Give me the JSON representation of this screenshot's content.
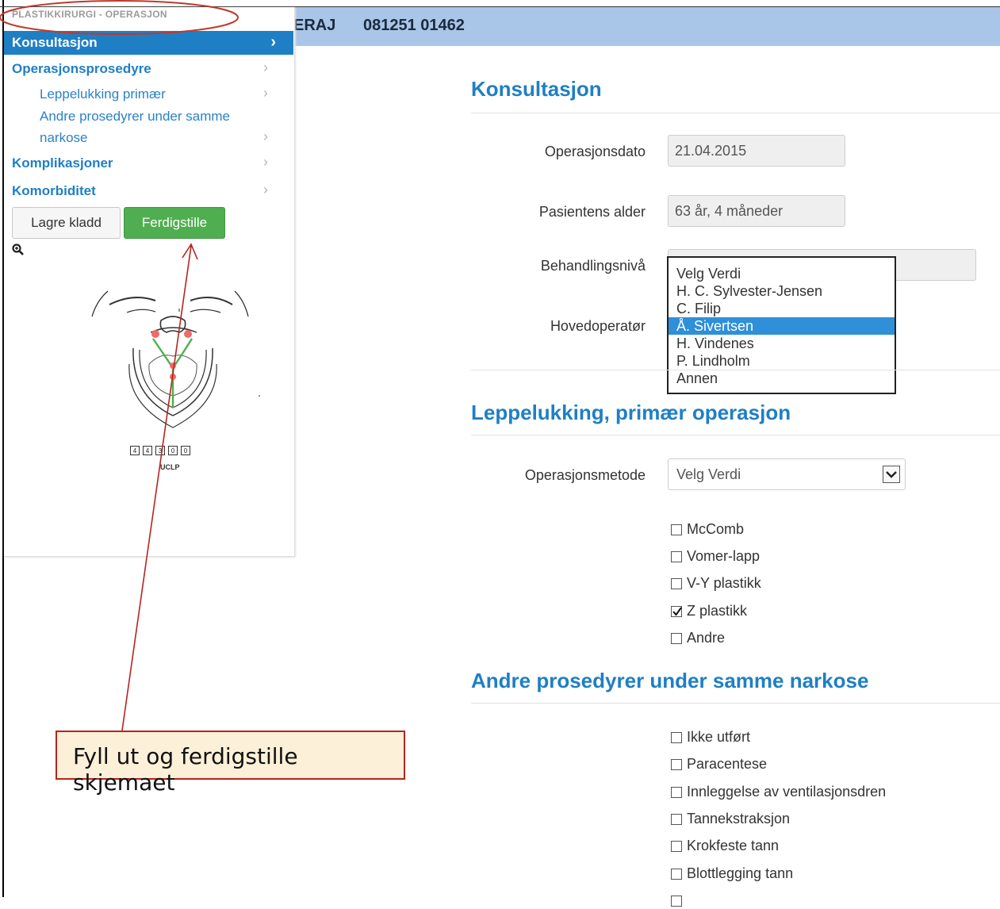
{
  "header": {
    "patient_name_fragment": "ERAJ",
    "patient_id": "081251 01462"
  },
  "sidebar": {
    "title": "PLASTIKKIRURGI - OPERASJON",
    "active_item": "Konsultasjon",
    "items": [
      {
        "label": "Operasjonsprosedyre"
      },
      {
        "label": "Leppelukking primær"
      },
      {
        "label": "Andre prosedyrer under samme"
      },
      {
        "label": "narkose"
      },
      {
        "label": "Komplikasjoner"
      },
      {
        "label": "Komorbiditet"
      }
    ],
    "save_draft_label": "Lagre kladd",
    "finish_label": "Ferdigstille",
    "zoom_icon": "magnifier-icon",
    "diagram_codes": [
      "4",
      "4",
      "3",
      "0",
      "0"
    ],
    "diagram_label": "UCLP"
  },
  "konsultasjon": {
    "title": "Konsultasjon",
    "operasjonsdato_label": "Operasjonsdato",
    "operasjonsdato_value": "21.04.2015",
    "alder_label": "Pasientens alder",
    "alder_value": "63 år, 4 måneder",
    "behandlingsniva_label": "Behandlingsnivå",
    "hovedoperator_label": "Hovedoperatør",
    "hovedoperator_options": [
      "Velg Verdi",
      "H. C. Sylvester-Jensen",
      "C. Filip",
      "Å. Sivertsen",
      "H. Vindenes",
      "P. Lindholm",
      "Annen"
    ],
    "hovedoperator_selected": "Å. Sivertsen"
  },
  "leppelukking": {
    "title": "Leppelukking, primær operasjon",
    "metode_label": "Operasjonsmetode",
    "metode_value": "Velg Verdi",
    "checkboxes": [
      {
        "label": "McComb",
        "checked": false
      },
      {
        "label": "Vomer-lapp",
        "checked": false
      },
      {
        "label": "V-Y plastikk",
        "checked": false
      },
      {
        "label": "Z plastikk",
        "checked": true
      },
      {
        "label": "Andre",
        "checked": false
      }
    ]
  },
  "andre_prosedyrer": {
    "title": "Andre prosedyrer under samme narkose",
    "checkboxes": [
      {
        "label": "Ikke utført",
        "checked": false
      },
      {
        "label": "Paracentese",
        "checked": false
      },
      {
        "label": "Innleggelse av ventilasjonsdren",
        "checked": false
      },
      {
        "label": "Tannekstraksjon",
        "checked": false
      },
      {
        "label": "Krokfeste tann",
        "checked": false
      },
      {
        "label": "Blottlegging tann",
        "checked": false
      }
    ]
  },
  "annotation": {
    "callout_text": "Fyll ut og ferdigstille skjemaet",
    "accent_color": "#b3261e"
  },
  "colors": {
    "brand_blue": "#1f7fc4",
    "header_bg": "#a9c5e8",
    "finish_green": "#4fae4f",
    "selected_option": "#2f8fd8"
  }
}
